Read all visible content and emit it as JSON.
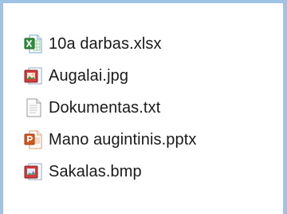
{
  "files": [
    {
      "name": "10a darbas.xlsx",
      "icon": "excel-file-icon"
    },
    {
      "name": "Augalai.jpg",
      "icon": "image-file-icon"
    },
    {
      "name": "Dokumentas.txt",
      "icon": "text-file-icon"
    },
    {
      "name": "Mano augintinis.pptx",
      "icon": "powerpoint-file-icon"
    },
    {
      "name": "Sakalas.bmp",
      "icon": "bitmap-file-icon"
    }
  ],
  "colors": {
    "window_border": "#9ec3e6",
    "background": "#ffffff",
    "text": "#1a1a1a",
    "excel_green": "#2f8f3a",
    "image_red": "#cf3e3e",
    "powerpoint_orange": "#d35a1f"
  }
}
